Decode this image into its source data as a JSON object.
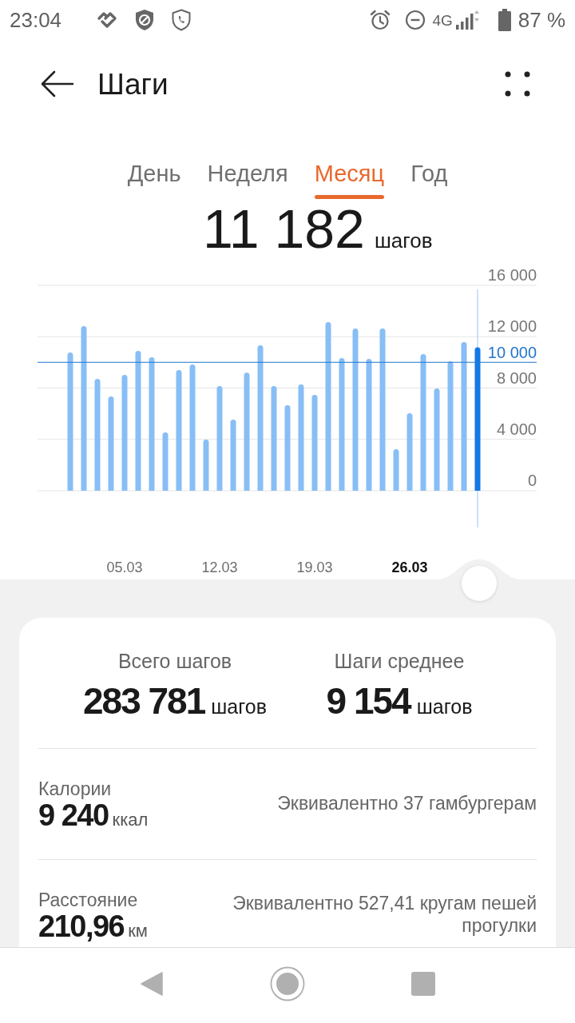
{
  "status_bar": {
    "time": "23:04",
    "network": "4G",
    "battery": "87 %"
  },
  "header": {
    "title": "Шаги"
  },
  "tabs": [
    {
      "label": "День",
      "selected": false
    },
    {
      "label": "Неделя",
      "selected": false
    },
    {
      "label": "Месяц",
      "selected": true
    },
    {
      "label": "Год",
      "selected": false
    }
  ],
  "summary": {
    "value": "11 182",
    "unit": "шагов"
  },
  "chart": {
    "chart_data": {
      "type": "bar",
      "categories": [
        null,
        null,
        null,
        null,
        "05.03",
        null,
        null,
        null,
        null,
        null,
        null,
        "12.03",
        null,
        null,
        null,
        null,
        null,
        null,
        "19.03",
        null,
        null,
        null,
        null,
        null,
        null,
        "26.03",
        null,
        null,
        null,
        null,
        null
      ],
      "series": [
        {
          "color": "#88bef6",
          "values": [
            10770,
            12830,
            8720,
            7350,
            9030,
            10900,
            10400,
            4550,
            9400,
            9840,
            3980,
            8160,
            5540,
            9200,
            11330,
            8160,
            6660,
            8280,
            7470,
            13140,
            10340,
            12640,
            10270,
            12640,
            3240,
            6040,
            10650,
            7970,
            10090,
            11580,
            null
          ]
        },
        {
          "color": "#1479e6",
          "values": [
            null,
            null,
            null,
            null,
            null,
            null,
            null,
            null,
            null,
            null,
            null,
            null,
            null,
            null,
            null,
            null,
            null,
            null,
            null,
            null,
            null,
            null,
            null,
            null,
            null,
            null,
            null,
            null,
            null,
            null,
            11180
          ]
        }
      ],
      "stacked": true,
      "grid": true,
      "ylim": [
        0,
        16000
      ],
      "yticks": [
        {
          "value": 0,
          "label": "0"
        },
        {
          "value": 4000,
          "label": "4 000"
        },
        {
          "value": 8000,
          "label": "8 000"
        },
        {
          "value": 12000,
          "label": "12 000"
        },
        {
          "value": 16000,
          "label": "16 000"
        }
      ],
      "ref_lines": [
        {
          "axis": "y",
          "value": 10000,
          "label": "10 000",
          "color": "#2277cc"
        }
      ]
    }
  },
  "totals": [
    {
      "label": "Всего шагов",
      "value": "283 781",
      "unit": "шагов"
    },
    {
      "label": "Шаги среднее",
      "value": "9 154",
      "unit": "шагов"
    }
  ],
  "metrics": [
    {
      "label": "Калории",
      "value": "9 240",
      "unit": "ккал",
      "note": "Эквивалентно 37 гамбургерам"
    },
    {
      "label": "Расстояние",
      "value": "210,96",
      "unit": "км",
      "note": "Эквивалентно 527,41 кругам пешей прогулки"
    }
  ]
}
